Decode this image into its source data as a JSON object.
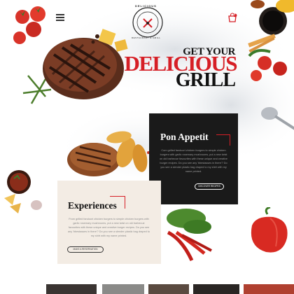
{
  "header": {
    "logo_text_top": "DELICIOUS",
    "logo_text_bottom": "RESTAURANT & GRILL"
  },
  "hero": {
    "line1": "GET YOUR",
    "line2": "DELICIOUS",
    "line3": "GRILL"
  },
  "card_dark": {
    "title": "Pon Appetit",
    "body": "Corn grilled fandoori chicken burgers to simple chicken burgers with garlic rosemary mushrooms, put a new twist on old barbecue favourites with these unique and creative burger recipes. Do you see any 'bbestasses in there'? Do you see a slender plastic bag draped to my shirt with my name printed.",
    "button": "DISCOVER RECIPES"
  },
  "card_light": {
    "title": "Experiences",
    "body": "From grilled fandoori chicken burgers to simple chicken burgers with garlic rosemary mushrooms, put a new twist on old barbecue favourites with these unique and creative burger recipes. Do you see any 'bbestasses in there'? Do you see a slender plastic bag draped to my shirt with my name printed.",
    "button": "MAKE A RESERVATION"
  },
  "colors": {
    "accent": "#d61f26",
    "dark_card": "#1a1a1a",
    "light_card": "#f3ece4"
  },
  "icons": [
    "menu-icon",
    "cart-icon",
    "logo-emblem-icon"
  ],
  "header_cart_count": "0"
}
